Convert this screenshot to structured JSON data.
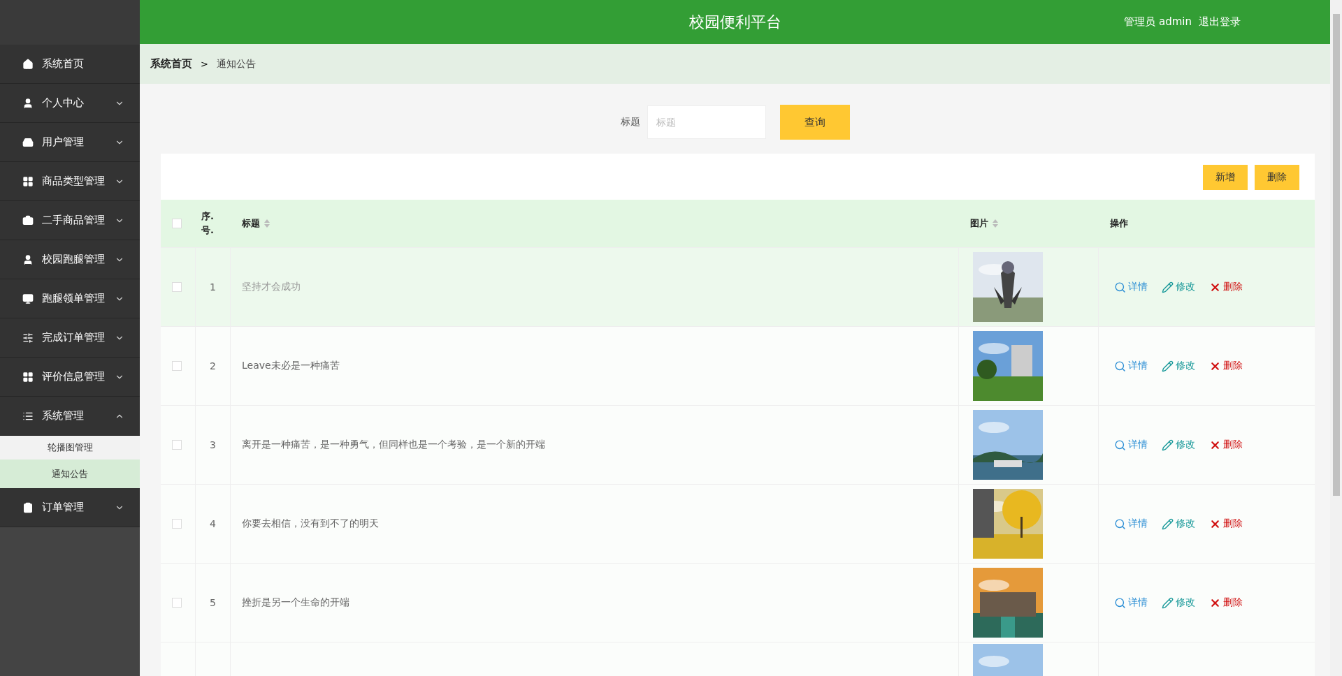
{
  "header": {
    "title": "校园便利平台",
    "user": "管理员 admin",
    "logout": "退出登录"
  },
  "sidebar": {
    "items": [
      {
        "label": "系统首页"
      },
      {
        "label": "个人中心",
        "expanded": false
      },
      {
        "label": "用户管理",
        "expanded": false
      },
      {
        "label": "商品类型管理",
        "expanded": false
      },
      {
        "label": "二手商品管理",
        "expanded": false
      },
      {
        "label": "校园跑腿管理",
        "expanded": false
      },
      {
        "label": "跑腿领单管理",
        "expanded": false
      },
      {
        "label": "完成订单管理",
        "expanded": false
      },
      {
        "label": "评价信息管理",
        "expanded": false
      },
      {
        "label": "系统管理",
        "expanded": true,
        "children": [
          {
            "label": "轮播图管理",
            "selected": false
          },
          {
            "label": "通知公告",
            "selected": true
          }
        ]
      },
      {
        "label": "订单管理",
        "expanded": false
      }
    ]
  },
  "breadcrumb": [
    "系统首页",
    "通知公告"
  ],
  "breadcrumb_separator": ">",
  "search": {
    "label": "标题",
    "placeholder": "标题",
    "button": "查询"
  },
  "toolbar": [
    "新增",
    "删除"
  ],
  "table": {
    "all_checked": false,
    "columns": [
      {
        "label": "序.号.",
        "sortable": false
      },
      {
        "label": "标题",
        "sortable": true
      },
      {
        "label": "图片",
        "sortable": true
      },
      {
        "label": "操作",
        "sortable": false
      }
    ],
    "rows": [
      {
        "checked": false,
        "index": "1",
        "title": "坚持才会成功",
        "hovered": true,
        "picture": {
          "kind": "picture"
        },
        "actions": [
          {
            "kind": "detail",
            "label": "详情"
          },
          {
            "kind": "edit",
            "label": "修改"
          },
          {
            "kind": "delete",
            "label": "删除"
          }
        ]
      },
      {
        "checked": false,
        "index": "2",
        "title": "Leave未必是一种痛苦",
        "hovered": false,
        "picture": {
          "kind": "picture"
        },
        "actions": [
          {
            "kind": "detail",
            "label": "详情"
          },
          {
            "kind": "edit",
            "label": "修改"
          },
          {
            "kind": "delete",
            "label": "删除"
          }
        ]
      },
      {
        "checked": false,
        "index": "3",
        "title": "离开是一种痛苦，是一种勇气，但同样也是一个考验，是一个新的开端",
        "hovered": false,
        "picture": {
          "kind": "picture"
        },
        "actions": [
          {
            "kind": "detail",
            "label": "详情"
          },
          {
            "kind": "edit",
            "label": "修改"
          },
          {
            "kind": "delete",
            "label": "删除"
          }
        ]
      },
      {
        "checked": false,
        "index": "4",
        "title": "你要去相信，没有到不了的明天",
        "hovered": false,
        "picture": {
          "kind": "picture"
        },
        "actions": [
          {
            "kind": "detail",
            "label": "详情"
          },
          {
            "kind": "edit",
            "label": "修改"
          },
          {
            "kind": "delete",
            "label": "删除"
          }
        ]
      },
      {
        "checked": false,
        "index": "5",
        "title": "挫折是另一个生命的开端",
        "hovered": false,
        "picture": {
          "kind": "picture"
        },
        "actions": [
          {
            "kind": "detail",
            "label": "详情"
          },
          {
            "kind": "edit",
            "label": "修改"
          },
          {
            "kind": "delete",
            "label": "删除"
          }
        ]
      },
      {
        "hovered": false,
        "picture": {
          "kind": "picture"
        }
      }
    ]
  }
}
